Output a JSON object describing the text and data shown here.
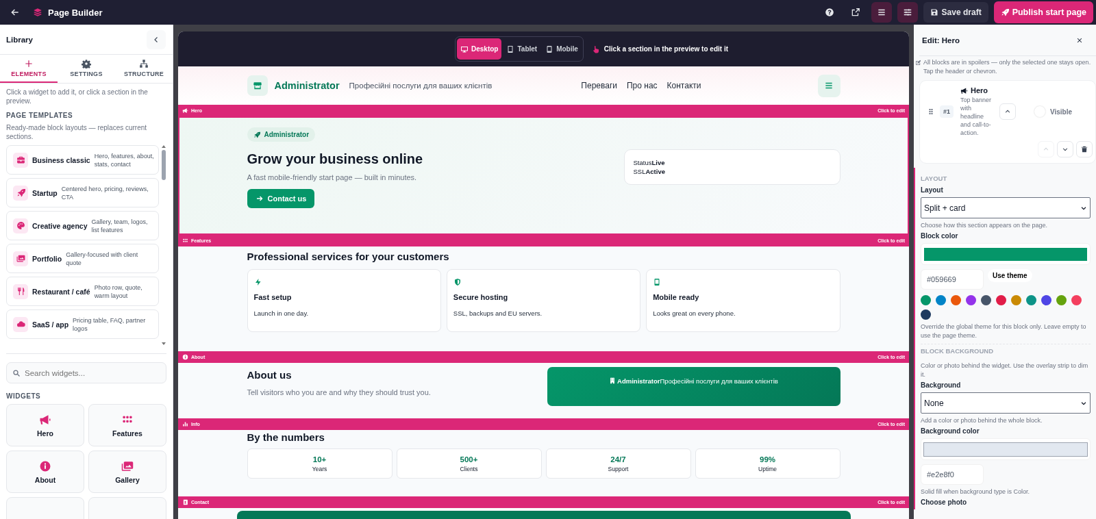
{
  "topbar": {
    "title": "Page Builder",
    "save": "Save draft",
    "publish": "Publish start page"
  },
  "library": {
    "title": "Library",
    "tabs": [
      {
        "label": "ELEMENTS",
        "kind": "plus",
        "selected": true
      },
      {
        "label": "SETTINGS",
        "kind": "gear",
        "selected": false
      },
      {
        "label": "STRUCTURE",
        "kind": "sitemap",
        "selected": false
      }
    ],
    "intro": "Click a widget to add it, or click a section in the preview.",
    "templates_heading": "PAGE TEMPLATES",
    "templates_note": "Ready-made block layouts — replaces current sections.",
    "templates": [
      {
        "kind": "briefcase",
        "name": "Business classic",
        "desc": "Hero, features, about, stats, contact"
      },
      {
        "kind": "rocket",
        "name": "Startup",
        "desc": "Centered hero, pricing, reviews, CTA"
      },
      {
        "kind": "palette",
        "name": "Creative agency",
        "desc": "Gallery, team, logos, list features"
      },
      {
        "kind": "images",
        "name": "Portfolio",
        "desc": "Gallery-focused with client quote"
      },
      {
        "kind": "utensils",
        "name": "Restaurant / café",
        "desc": "Photo row, quote, warm layout"
      },
      {
        "kind": "cloud",
        "name": "SaaS / app",
        "desc": "Pricing table, FAQ, partner logos"
      }
    ],
    "search_placeholder": "Search widgets...",
    "widgets_heading": "WIDGETS",
    "widgets": [
      {
        "kind": "megaphone",
        "label": "Hero"
      },
      {
        "kind": "dots",
        "label": "Features"
      },
      {
        "kind": "info",
        "label": "About"
      },
      {
        "kind": "images",
        "label": "Gallery"
      }
    ]
  },
  "preview": {
    "devices": [
      {
        "kind": "desktop",
        "label": "Desktop",
        "selected": true
      },
      {
        "kind": "tablet",
        "label": "Tablet",
        "selected": false
      },
      {
        "kind": "mobile",
        "label": "Mobile",
        "selected": false
      }
    ],
    "hint": "Click a section in the preview to edit it",
    "brand": "Administrator",
    "tagline": "Професійні послуги для ваших клієнтів",
    "nav": [
      "Переваги",
      "Про нас",
      "Контакти"
    ],
    "sections": [
      {
        "kind": "hero",
        "label": "Hero",
        "action": "Click to edit",
        "selected": true,
        "badge": "Administrator",
        "title": "Grow your business online",
        "subtitle": "A fast mobile-friendly start page — built in minutes.",
        "button": "Contact us",
        "card": [
          "Status**Live**",
          "SSL**Active**"
        ]
      },
      {
        "kind": "features",
        "label": "Features",
        "action": "Click to edit",
        "selected": false,
        "title": "Professional services for your customers",
        "cards": [
          {
            "kind": "bolt",
            "title": "Fast setup",
            "text": "Launch in one day."
          },
          {
            "kind": "shield",
            "title": "Secure hosting",
            "text": "SSL, backups and EU servers."
          },
          {
            "kind": "mobile",
            "title": "Mobile ready",
            "text": "Looks great on every phone."
          }
        ]
      },
      {
        "kind": "about",
        "label": "About",
        "action": "Click to edit",
        "selected": false,
        "title": "About us",
        "text": "Tell visitors who you are and why they should trust you.",
        "banner": "**Administrator**Професійні послуги для ваших клієнтів"
      },
      {
        "kind": "info",
        "label": "Info",
        "action": "Click to edit",
        "selected": false,
        "title": "By the numbers",
        "stats": [
          {
            "value": "10+",
            "label": "Years"
          },
          {
            "value": "500+",
            "label": "Clients"
          },
          {
            "value": "24/7",
            "label": "Support"
          },
          {
            "value": "99%",
            "label": "Uptime"
          }
        ]
      },
      {
        "kind": "contact",
        "label": "Contact",
        "action": "Click to edit",
        "selected": false
      }
    ]
  },
  "editor": {
    "title": "Edit: Hero",
    "note": "All blocks are in spoilers — only the selected one stays open. Tap the header or chevron.",
    "block": {
      "number": "#1",
      "name": "Hero",
      "desc": "Top banner with headline and call-to-action.",
      "visible_label": "Visible",
      "visible": false
    },
    "layout_heading": "LAYOUT",
    "layout": {
      "label": "Layout",
      "value": "Split + card",
      "hint": "Choose how this section appears on the page."
    },
    "block_color": {
      "label": "Block color",
      "value": "#059669",
      "button": "Use theme",
      "hint": "Override the global theme for this block only. Leave empty to use the page theme.",
      "swatches": [
        {
          "color": "#059669"
        },
        {
          "color": "#0284c7"
        },
        {
          "color": "#ea580c"
        },
        {
          "color": "#9333ea"
        },
        {
          "color": "#475569"
        },
        {
          "color": "#e11d48"
        },
        {
          "color": "#ca8a04"
        },
        {
          "color": "#0d9488"
        },
        {
          "color": "#4f46e5"
        },
        {
          "color": "#65a30d"
        },
        {
          "color": "#f43f5e"
        },
        {
          "color": "#1e3a5f"
        }
      ]
    },
    "background_heading": "BLOCK BACKGROUND",
    "background_note": "Color or photo behind the widget. Use the overlay strip to dim it.",
    "background": {
      "label": "Background",
      "value": "None",
      "hint": "Add a color or photo behind the whole block."
    },
    "background_color": {
      "label": "Background color",
      "value": "#e2e8f0",
      "hint": "Solid fill when background type is Color."
    },
    "choose_photo": "Choose photo"
  }
}
